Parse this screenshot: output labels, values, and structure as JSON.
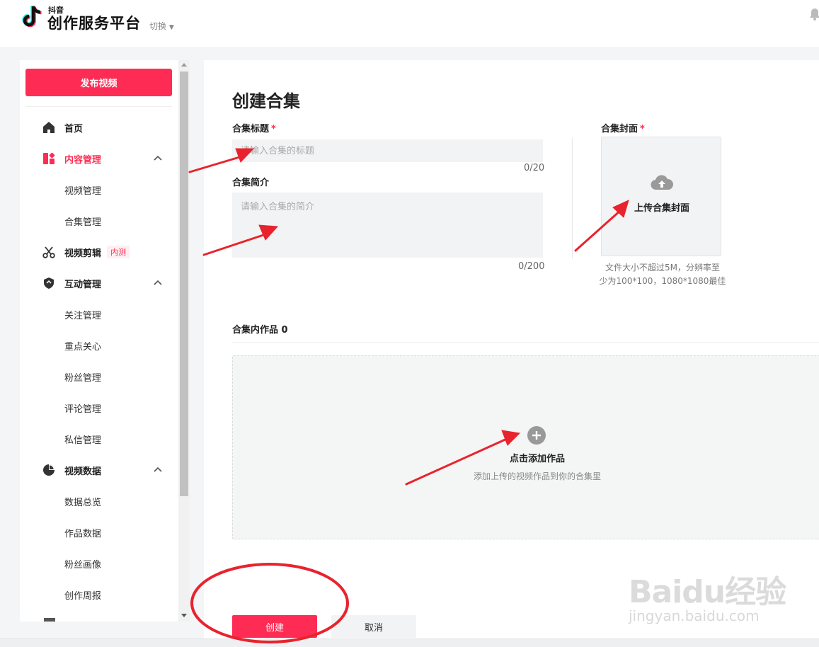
{
  "header": {
    "brand_small": "抖音",
    "brand_title": "创作服务平台",
    "switch_label": "切换"
  },
  "sidebar": {
    "publish_label": "发布视频",
    "nav": {
      "home": "首页",
      "content": "内容管理",
      "content_sub": [
        "视频管理",
        "合集管理"
      ],
      "edit": "视频剪辑",
      "edit_badge": "内测",
      "interact": "互动管理",
      "interact_sub": [
        "关注管理",
        "重点关心",
        "粉丝管理",
        "评论管理",
        "私信管理"
      ],
      "data": "视频数据",
      "data_sub": [
        "数据总览",
        "作品数据",
        "粉丝画像",
        "创作周报"
      ]
    }
  },
  "form": {
    "page_title": "创建合集",
    "title_label": "合集标题",
    "title_placeholder": "请输入合集的标题",
    "title_count": "0/20",
    "desc_label": "合集简介",
    "desc_placeholder": "请输入合集的简介",
    "desc_count": "0/200",
    "cover_label": "合集封面",
    "cover_upload": "上传合集封面",
    "cover_hint_1": "文件大小不超过5M，分辨率至",
    "cover_hint_2": "少为100*100，1080*1080最佳",
    "required_mark": "*",
    "works_label": "合集内作品 0",
    "add_title": "点击添加作品",
    "add_sub": "添加上传的视频作品到你的合集里",
    "create_label": "创建",
    "cancel_label": "取消"
  },
  "watermark": {
    "main": "Baidu经验",
    "sub": "jingyan.baidu.com"
  },
  "colors": {
    "accent": "#fe2c55",
    "annotation": "#e8232d",
    "panel_bg": "#ffffff",
    "page_bg": "#f4f5f7"
  },
  "icons": [
    "douyin-logo-icon",
    "bell-icon",
    "home-icon",
    "content-grid-icon",
    "scissors-icon",
    "shield-icon",
    "pie-chart-icon",
    "chevron-up-icon",
    "cloud-upload-icon",
    "plus-circle-icon"
  ]
}
